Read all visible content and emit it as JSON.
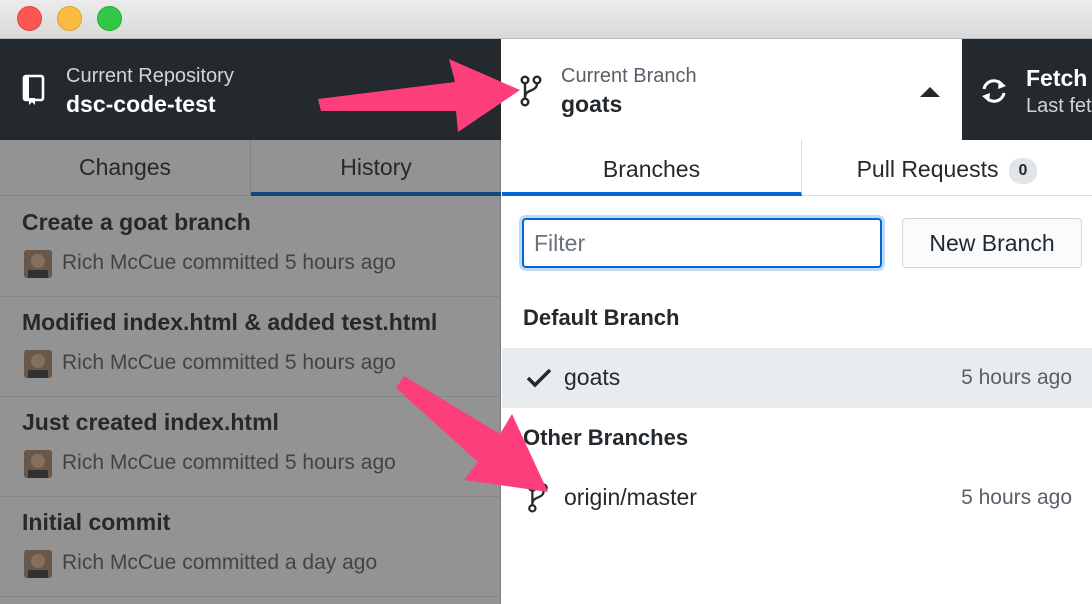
{
  "toolbar": {
    "repo_label": "Current Repository",
    "repo_name": "dsc-code-test",
    "branch_label": "Current Branch",
    "branch_name": "goats",
    "fetch_label": "Fetch origin",
    "fetch_sub": "Last fetched"
  },
  "left_tabs": {
    "changes": "Changes",
    "history": "History"
  },
  "commits": [
    {
      "title": "Create a goat branch",
      "meta": "Rich McCue committed 5 hours ago"
    },
    {
      "title": "Modified index.html & added test.html",
      "meta": "Rich McCue committed 5 hours ago"
    },
    {
      "title": "Just created index.html",
      "meta": "Rich McCue committed 5 hours ago"
    },
    {
      "title": "Initial commit",
      "meta": "Rich McCue committed a day ago"
    }
  ],
  "right_tabs": {
    "branches": "Branches",
    "pull_requests": "Pull Requests",
    "pr_count": "0"
  },
  "filter": {
    "placeholder": "Filter",
    "value": ""
  },
  "new_branch_label": "New Branch",
  "default_section": "Default Branch",
  "other_section": "Other Branches",
  "default_branch": {
    "name": "goats",
    "time": "5 hours ago",
    "icon": "check-icon"
  },
  "other_branch": {
    "name": "origin/master",
    "time": "5 hours ago",
    "icon": "git-branch-icon"
  },
  "colors": {
    "accent": "#0366d6",
    "toolbar_bg": "#24292e",
    "annotation_arrow": "#fc3e7a"
  }
}
